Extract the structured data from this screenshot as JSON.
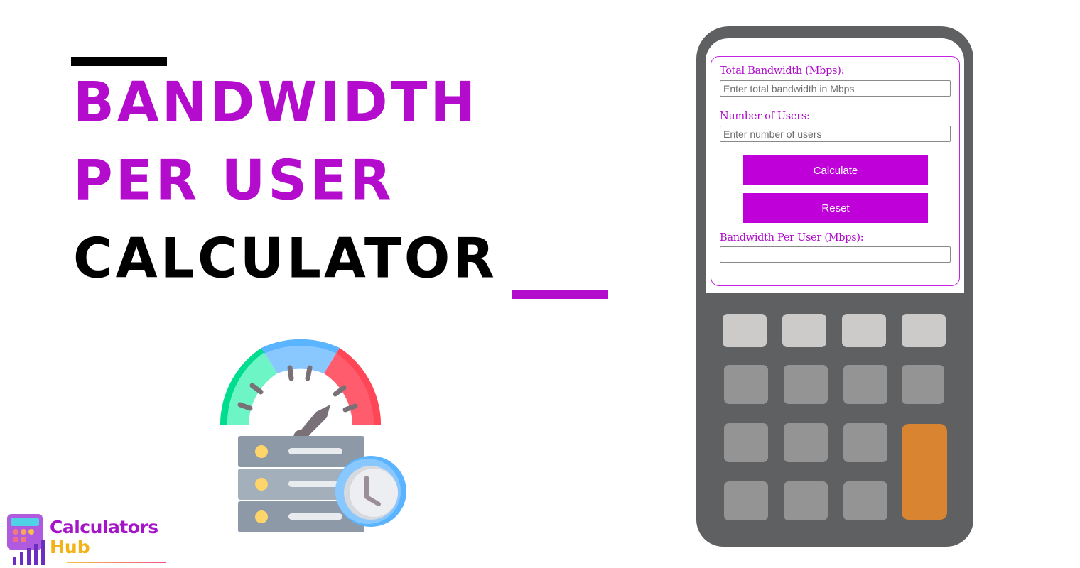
{
  "hero": {
    "title_line1": "BANDWIDTH",
    "title_line2": "PER USER",
    "title_line3": "CALCULATOR",
    "accent_color": "#b40ccd"
  },
  "illustration": {
    "icon": "speedometer-server-clock-icon",
    "gauge_colors": [
      "#00dd8f",
      "#6ef5c6",
      "#5ab4ff",
      "#88c8ff",
      "#ff5d6d",
      "#ff4656"
    ]
  },
  "logo": {
    "line1": "Calculators",
    "line2": "Hub"
  },
  "calculator": {
    "fields": [
      {
        "label": "Total Bandwidth (Mbps):",
        "placeholder": "Enter total bandwidth in Mbps",
        "value": ""
      },
      {
        "label": "Number of Users:",
        "placeholder": "Enter number of users",
        "value": ""
      }
    ],
    "buttons": {
      "calculate": "Calculate",
      "reset": "Reset"
    },
    "result": {
      "label": "Bandwidth Per User (Mbps):",
      "value": ""
    },
    "button_color": "#bf00d8",
    "body_color": "#5f6062",
    "equals_key_color": "#d98430"
  }
}
